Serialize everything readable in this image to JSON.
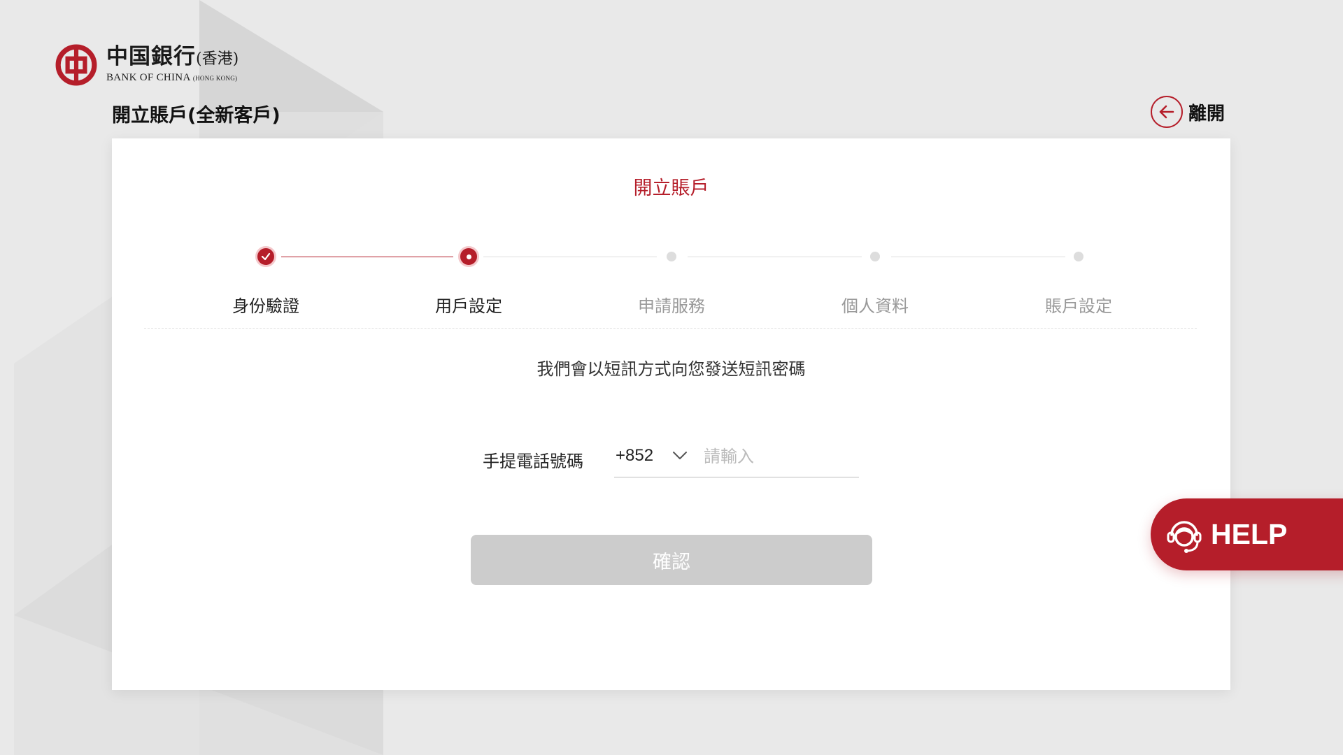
{
  "brand": {
    "chinese_name": "中国銀行",
    "chinese_suffix": "(香港)",
    "english_name": "BANK OF CHINA",
    "english_suffix": "(HONG KONG)",
    "color": "#b51e2a"
  },
  "header": {
    "page_title": "開立賬戶(全新客戶)",
    "exit_label": "離開",
    "exit_icon": "arrow-left-icon"
  },
  "form": {
    "title": "開立賬戶",
    "steps": [
      {
        "label": "身份驗證",
        "status": "completed"
      },
      {
        "label": "用戶設定",
        "status": "current"
      },
      {
        "label": "申請服務",
        "status": "pending"
      },
      {
        "label": "個人資料",
        "status": "pending"
      },
      {
        "label": "賬戶設定",
        "status": "pending"
      }
    ],
    "sms_info": "我們會以短訊方式向您發送短訊密碼",
    "phone_label": "手提電話號碼",
    "country_code": "+852",
    "phone_value": "",
    "phone_placeholder": "請輸入",
    "confirm_label": "確認"
  },
  "help": {
    "label": "HELP",
    "icon": "headset-agent-icon"
  }
}
